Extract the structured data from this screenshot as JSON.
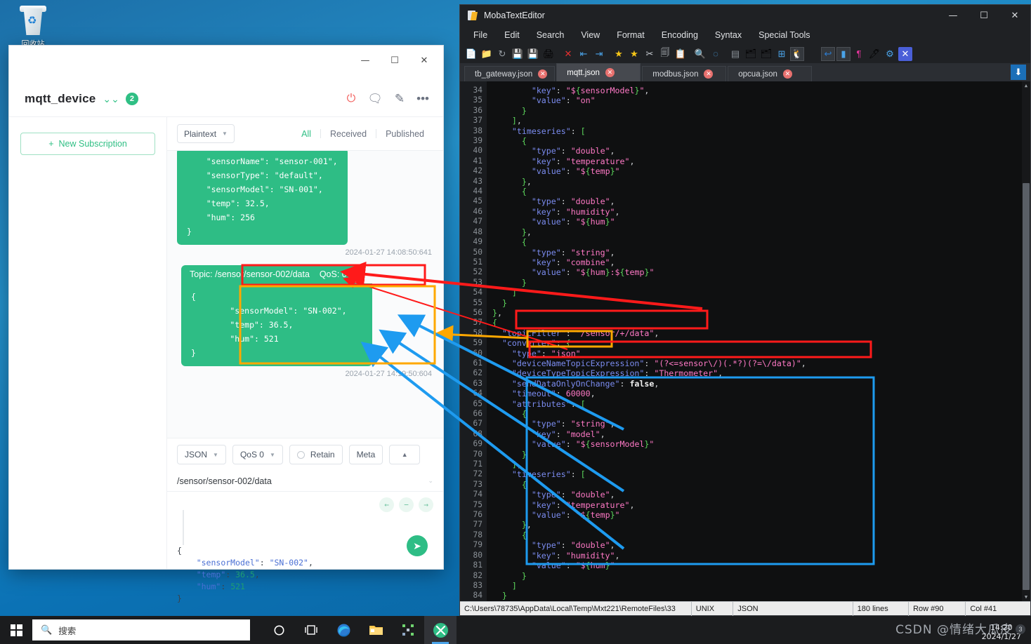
{
  "desktop": {
    "recycle_bin_label": "回收站"
  },
  "mqttx": {
    "window_buttons": {
      "minimize": "—",
      "maximize": "☐",
      "close": "✕"
    },
    "connection": {
      "name": "mqtt_device",
      "badge": "2"
    },
    "header_icons": [
      "power-icon",
      "message-icon",
      "edit-icon",
      "more-icon"
    ],
    "subscriptions": {
      "new_button": "New Subscription",
      "plus": "+"
    },
    "toolbar": {
      "format_select": "Plaintext",
      "filters": [
        "All",
        "Received",
        "Published"
      ],
      "active_filter": "All"
    },
    "messages": [
      {
        "payload": "    \"sensorName\": \"sensor-001\",\n    \"sensorType\": \"default\",\n    \"sensorModel\": \"SN-001\",\n    \"temp\": 32.5,\n    \"hum\": 256\n}",
        "timestamp": "2024-01-27 14:08:50:641"
      },
      {
        "topic_line": "Topic: /sensor/sensor-002/data    QoS: 0",
        "payload": "{\n        \"sensorModel\": \"SN-002\",\n        \"temp\": 36.5,\n        \"hum\": 521\n}",
        "timestamp": "2024-01-27 14:19:50:604"
      }
    ],
    "composer": {
      "format": "JSON",
      "qos": "QoS 0",
      "retain": "Retain",
      "meta": "Meta",
      "collapse": "▲",
      "topic": "/sensor/sensor-002/data",
      "payload_lines": [
        {
          "indent": 0,
          "text": "{"
        },
        {
          "indent": 1,
          "key": "\"sensorModel\"",
          "value": "\"SN-002\"",
          "tail": ","
        },
        {
          "indent": 1,
          "key": "\"temp\"",
          "value": "36.5",
          "tail": ","
        },
        {
          "indent": 1,
          "key": "\"hum\"",
          "value": "521",
          "tail": ""
        },
        {
          "indent": 0,
          "text": "}"
        }
      ],
      "fold_buttons": [
        "←",
        "−",
        "→"
      ],
      "send_icon": "send-icon"
    }
  },
  "moba": {
    "title": "MobaTextEditor",
    "window_buttons": {
      "minimize": "—",
      "maximize": "☐",
      "close": "✕"
    },
    "menus": [
      "File",
      "Edit",
      "Search",
      "View",
      "Format",
      "Encoding",
      "Syntax",
      "Special Tools"
    ],
    "toolbar_icons": [
      "new-file-icon",
      "open-folder-icon",
      "reload-icon",
      "save-icon",
      "save-as-icon",
      "print-icon",
      "close-doc-icon",
      "outdent-icon",
      "indent-icon",
      "bookmark-icon",
      "bookmark-next-icon",
      "cut-icon",
      "copy-icon",
      "paste-icon",
      "search-icon",
      "find-replace-icon",
      "document-icon",
      "export-icon",
      "import-icon",
      "windows-format-icon",
      "linux-format-icon",
      "mac-format-icon",
      "undo-icon",
      "columns-icon",
      "pilcrow-icon",
      "highlighter-icon",
      "settings-icon",
      "close-x-icon"
    ],
    "tabs": [
      {
        "label": "tb_gateway.json",
        "active": false
      },
      {
        "label": "mqtt.json",
        "active": true
      },
      {
        "label": "modbus.json",
        "active": false
      },
      {
        "label": "opcua.json",
        "active": false
      }
    ],
    "tabs_download_icon": "download-icon",
    "first_line_number": 34,
    "code_lines": [
      "        \"key\": \"${sensorModel}\",",
      "        \"value\": \"on\"",
      "      }",
      "    ],",
      "    \"timeseries\": [",
      "      {",
      "        \"type\": \"double\",",
      "        \"key\": \"temperature\",",
      "        \"value\": \"${temp}\"",
      "      },",
      "      {",
      "        \"type\": \"double\",",
      "        \"key\": \"humidity\",",
      "        \"value\": \"${hum}\"",
      "      },",
      "      {",
      "        \"type\": \"string\",",
      "        \"key\": \"combine\",",
      "        \"value\": \"${hum}:${temp}\"",
      "      }",
      "    ]",
      "  }",
      "},",
      "{",
      "  \"topicFilter\": \"/sensor/+/data\",",
      "  \"converter\": {",
      "    \"type\": \"json\"",
      "    \"deviceNameTopicExpression\": \"(?<=sensor\\/)(.*?)(?=\\/data)\",",
      "    \"deviceTypeTopicExpression\": \"Thermometer\",",
      "    \"sendDataOnlyOnChange\": false,",
      "    \"timeout\": 60000,",
      "    \"attributes\": [",
      "      {",
      "        \"type\": \"string\",",
      "        \"key\": \"model\",",
      "        \"value\": \"${sensorModel}\"",
      "      }",
      "    ],",
      "    \"timeseries\": [",
      "      {",
      "        \"type\": \"double\",",
      "        \"key\": \"temperature\",",
      "        \"value\": \"${temp}\"",
      "      },",
      "      {",
      "        \"type\": \"double\",",
      "        \"key\": \"humidity\",",
      "        \"value\": \"${hum}\"",
      "      }",
      "    ]",
      "  }",
      "},",
      "{"
    ],
    "statusbar": {
      "path": "C:\\Users\\78735\\AppData\\Local\\Temp\\Mxt221\\RemoteFiles\\33",
      "line_ending": "UNIX",
      "syntax": "JSON",
      "lines": "180 lines",
      "row": "Row #90",
      "col": "Col #41"
    }
  },
  "annotations": {
    "red": "#ff1a1a",
    "orange": "#ffa800",
    "blue": "#1e9bf0"
  },
  "taskbar": {
    "search_placeholder": "搜索",
    "search_icon": "search-icon",
    "items": [
      "cortana-icon",
      "task-view-icon",
      "edge-icon",
      "file-explorer-icon",
      "app-icon",
      "mqttx-icon"
    ],
    "clock_time": "14:20",
    "clock_date": "2024/1/27"
  },
  "watermark": {
    "text": "CSDN @情绪大瓜皮",
    "badge": "3"
  }
}
